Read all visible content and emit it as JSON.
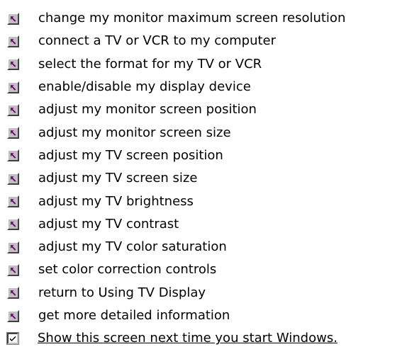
{
  "colors": {
    "background": "#ffffff",
    "text": "#000000",
    "button_face": "#c0c0c0",
    "arrow": "#800080"
  },
  "topics": [
    {
      "label": "change my monitor maximum screen resolution",
      "icon": "jump-arrow-icon"
    },
    {
      "label": "connect a TV or VCR to my computer",
      "icon": "jump-arrow-icon"
    },
    {
      "label": "select the format for my TV or VCR",
      "icon": "jump-arrow-icon"
    },
    {
      "label": "enable/disable my display device",
      "icon": "jump-arrow-icon"
    },
    {
      "label": "adjust my monitor screen position",
      "icon": "jump-arrow-icon"
    },
    {
      "label": "adjust my monitor screen size",
      "icon": "jump-arrow-icon"
    },
    {
      "label": "adjust my TV screen position",
      "icon": "jump-arrow-icon"
    },
    {
      "label": "adjust my TV screen size",
      "icon": "jump-arrow-icon"
    },
    {
      "label": "adjust my TV brightness",
      "icon": "jump-arrow-icon"
    },
    {
      "label": "adjust my TV contrast",
      "icon": "jump-arrow-icon"
    },
    {
      "label": "adjust my TV color saturation",
      "icon": "jump-arrow-icon"
    },
    {
      "label": "set color correction controls",
      "icon": "jump-arrow-icon"
    },
    {
      "label": "return to Using TV Display",
      "icon": "jump-arrow-icon"
    },
    {
      "label": "get more detailed information",
      "icon": "jump-arrow-icon"
    }
  ],
  "show_on_startup": {
    "label": "Show this screen next time you start Windows.",
    "checked": true,
    "icon": "checkmark-icon"
  }
}
